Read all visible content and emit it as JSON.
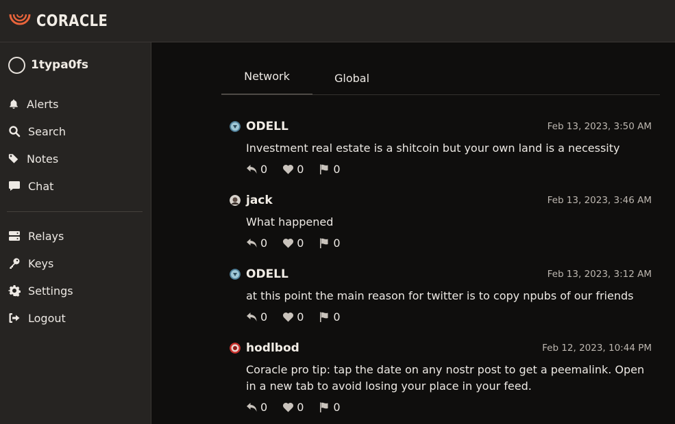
{
  "app": {
    "brand": "CORACLE",
    "accent": "#e8643b"
  },
  "sidebar": {
    "user": {
      "name": "1typa0fs"
    },
    "primary": [
      {
        "label": "Alerts",
        "icon": "bell-icon"
      },
      {
        "label": "Search",
        "icon": "search-icon"
      },
      {
        "label": "Notes",
        "icon": "tag-icon"
      },
      {
        "label": "Chat",
        "icon": "chat-icon"
      }
    ],
    "secondary": [
      {
        "label": "Relays",
        "icon": "server-icon"
      },
      {
        "label": "Keys",
        "icon": "key-icon"
      },
      {
        "label": "Settings",
        "icon": "gear-icon"
      },
      {
        "label": "Logout",
        "icon": "logout-icon"
      }
    ]
  },
  "tabs": [
    {
      "label": "Network",
      "active": true
    },
    {
      "label": "Global",
      "active": false
    }
  ],
  "notes": [
    {
      "author": "ODELL",
      "date": "Feb 13, 2023, 3:50 AM",
      "content": "Investment real estate is a shitcoin but your own land is a necessity",
      "replies": "0",
      "likes": "0",
      "flags": "0"
    },
    {
      "author": "jack",
      "date": "Feb 13, 2023, 3:46 AM",
      "content": "What happened",
      "replies": "0",
      "likes": "0",
      "flags": "0"
    },
    {
      "author": "ODELL",
      "date": "Feb 13, 2023, 3:12 AM",
      "content": "at this point the main reason for twitter is to copy npubs of our friends",
      "replies": "0",
      "likes": "0",
      "flags": "0"
    },
    {
      "author": "hodlbod",
      "date": "Feb 12, 2023, 10:44 PM",
      "content": "Coracle pro tip: tap the date on any nostr post to get a peemalink. Open in a new tab to avoid losing your place in your feed.",
      "replies": "0",
      "likes": "0",
      "flags": "0"
    }
  ]
}
